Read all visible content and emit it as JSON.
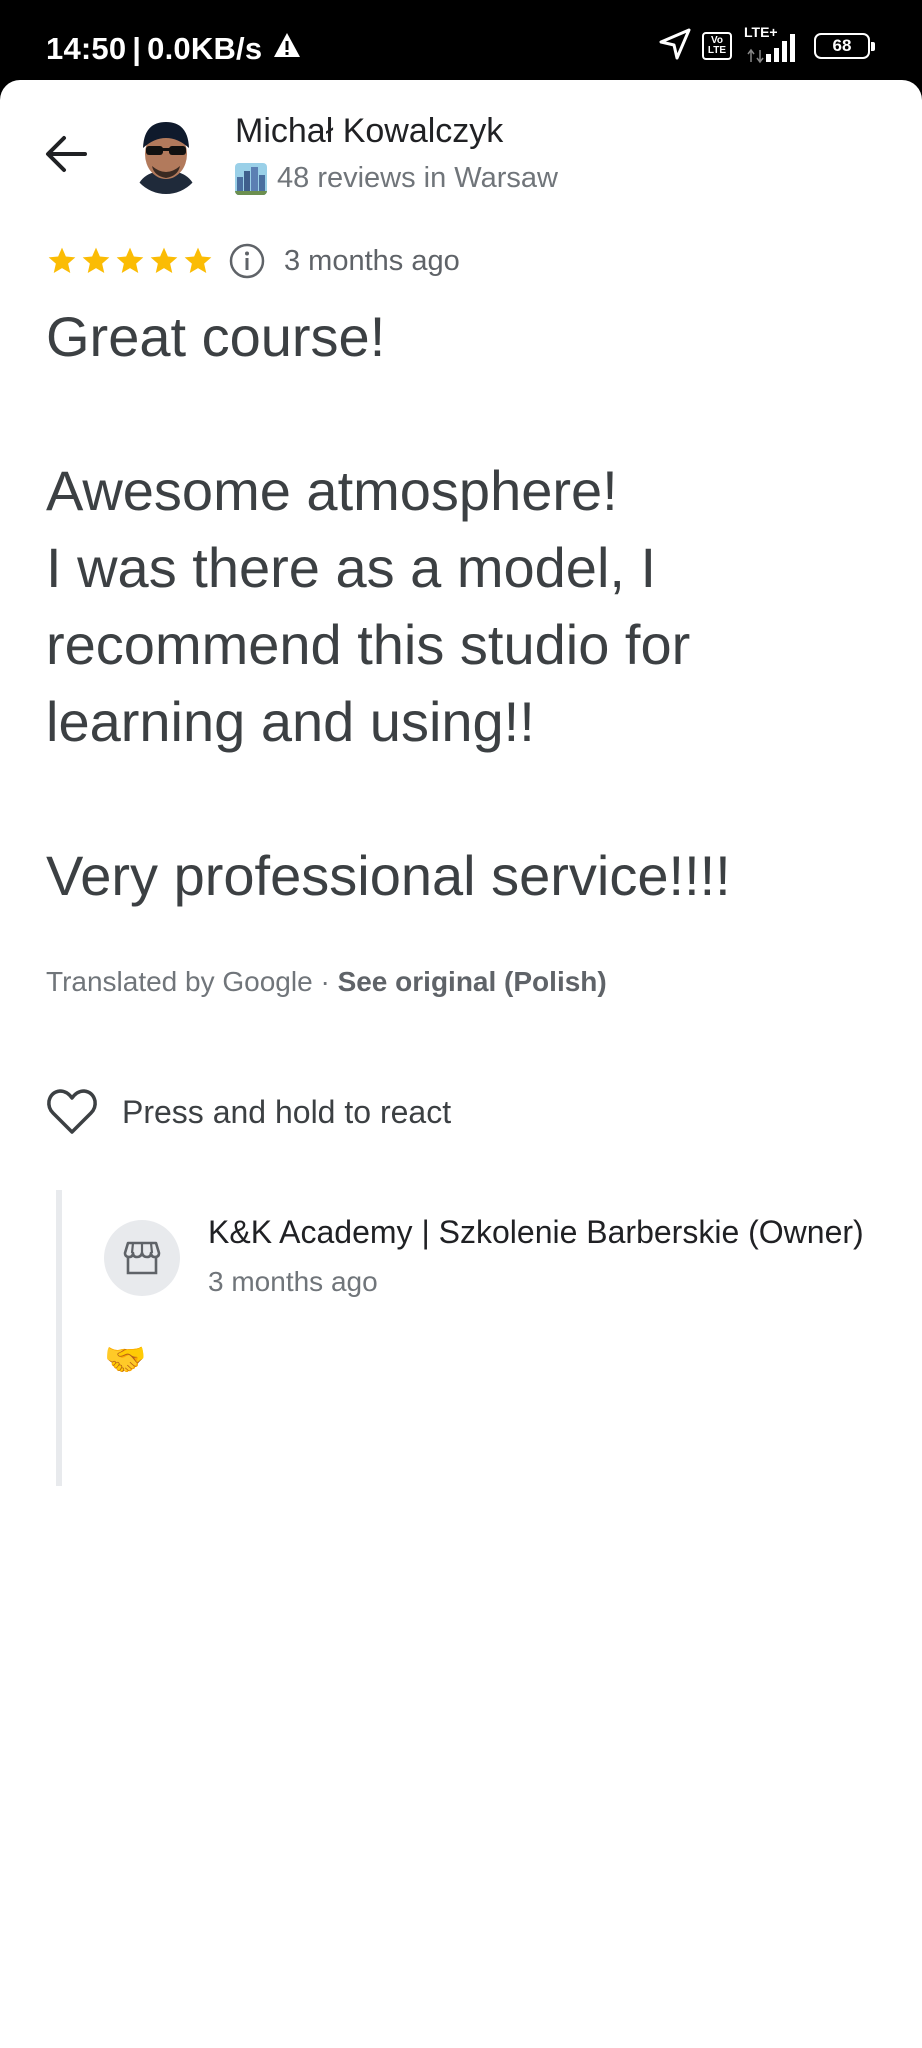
{
  "status_bar": {
    "time": "14:50",
    "separator": "|",
    "network_speed": "0.0KB/s",
    "volte_top": "Vo",
    "volte_bottom": "LTE",
    "lte_label": "LTE+",
    "battery": "68"
  },
  "reviewer": {
    "name": "Michał Kowalczyk",
    "meta": "48 reviews in Warsaw"
  },
  "review": {
    "rating": 5,
    "rating_max": 5,
    "time_ago": "3 months ago",
    "text": "Great course!\n\nAwesome atmosphere!\nI was there as a model, I recommend this studio for learning and using!!\n\nVery professional service!!!!",
    "translated_by": "Translated by Google · ",
    "see_original": "See original (Polish)"
  },
  "reaction": {
    "label": "Press and hold to react"
  },
  "owner_reply": {
    "name": "K&K Academy | Szkolenie Barberskie (Owner)",
    "time_ago": "3 months ago",
    "text": "🤝"
  },
  "colors": {
    "star": "#FBBC04",
    "text_primary": "#202124",
    "text_secondary": "#70757a"
  }
}
